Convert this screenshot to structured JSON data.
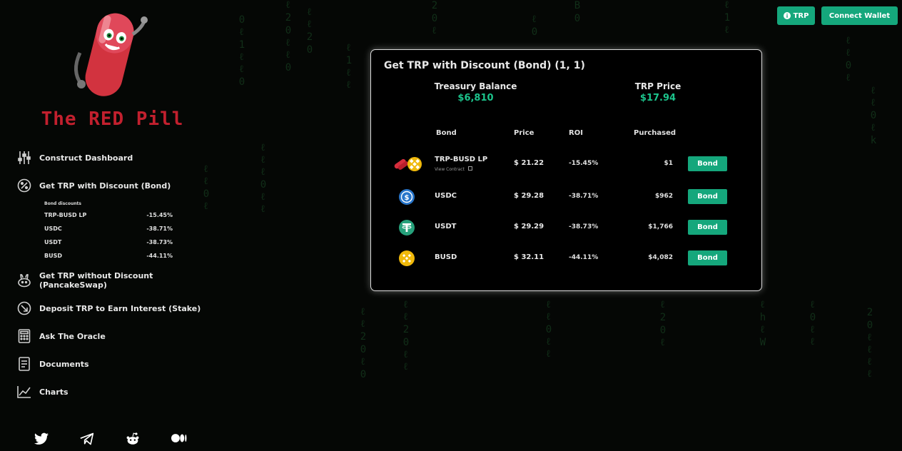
{
  "brand": {
    "name": "The RED Pill"
  },
  "nav": {
    "items": [
      {
        "id": "dashboard",
        "label": "Construct Dashboard",
        "icon": "sliders-icon"
      },
      {
        "id": "bond",
        "label": "Get TRP with Discount (Bond)",
        "icon": "discount-icon"
      },
      {
        "id": "pancake",
        "label": "Get TRP without Discount (PancakeSwap)",
        "icon": "bunny-icon"
      },
      {
        "id": "stake",
        "label": "Deposit TRP to Earn Interest (Stake)",
        "icon": "stake-icon"
      },
      {
        "id": "oracle",
        "label": "Ask The Oracle",
        "icon": "calculator-icon"
      },
      {
        "id": "docs",
        "label": "Documents",
        "icon": "document-icon"
      },
      {
        "id": "charts",
        "label": "Charts",
        "icon": "chart-icon"
      }
    ],
    "discounts": {
      "header": "Bond discounts",
      "rows": [
        {
          "name": "TRP-BUSD LP",
          "value": "-15.45%"
        },
        {
          "name": "USDC",
          "value": "-38.71%"
        },
        {
          "name": "USDT",
          "value": "-38.73%"
        },
        {
          "name": "BUSD",
          "value": "-44.11%"
        }
      ]
    }
  },
  "socials": [
    "twitter-icon",
    "telegram-icon",
    "reddit-icon",
    "medium-icon"
  ],
  "topbar": {
    "trp_label": "TRP",
    "connect_label": "Connect Wallet"
  },
  "card": {
    "title": "Get TRP with Discount (Bond) (1, 1)",
    "treasury_label": "Treasury Balance",
    "treasury_value": "$6,810",
    "price_label": "TRP Price",
    "price_value": "$17.94",
    "headers": {
      "bond": "Bond",
      "price": "Price",
      "roi": "ROI",
      "purchased": "Purchased"
    },
    "rows": [
      {
        "name": "TRP-BUSD LP",
        "sub": "View Contract",
        "price": "$ 21.22",
        "roi": "-15.45%",
        "purchased": "$1",
        "action": "Bond",
        "icon": "trp-busd-lp-icon"
      },
      {
        "name": "USDC",
        "price": "$ 29.28",
        "roi": "-38.71%",
        "purchased": "$962",
        "action": "Bond",
        "icon": "usdc-icon"
      },
      {
        "name": "USDT",
        "price": "$ 29.29",
        "roi": "-38.73%",
        "purchased": "$1,766",
        "action": "Bond",
        "icon": "usdt-icon"
      },
      {
        "name": "BUSD",
        "price": "$ 32.11",
        "roi": "-44.11%",
        "purchased": "$4,082",
        "action": "Bond",
        "icon": "busd-icon"
      }
    ]
  },
  "colors": {
    "accent": "#15a77c",
    "value_green": "#1cc48c",
    "brand_red": "#c2202e"
  }
}
